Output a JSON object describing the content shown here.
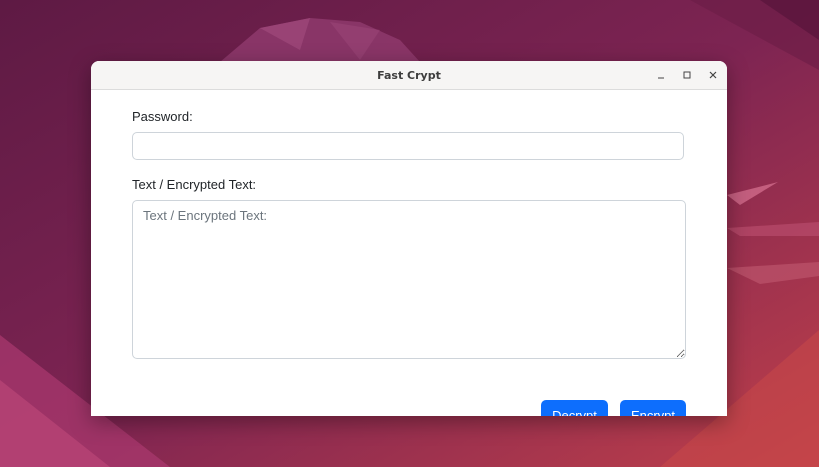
{
  "window": {
    "title": "Fast Crypt",
    "controls": {
      "minimize_icon": "minimize-icon",
      "maximize_icon": "maximize-icon",
      "close_icon": "close-icon"
    }
  },
  "form": {
    "password": {
      "label": "Password:",
      "value": "",
      "placeholder": ""
    },
    "text": {
      "label": "Text / Encrypted Text:",
      "value": "",
      "placeholder": "Text / Encrypted Text:"
    },
    "buttons": {
      "decrypt_label": "Decrypt",
      "encrypt_label": "Encrypt"
    }
  },
  "colors": {
    "primary_button": "#0d6efd",
    "titlebar_bg": "#f6f5f4",
    "wallpaper_base": "#7a2452"
  }
}
